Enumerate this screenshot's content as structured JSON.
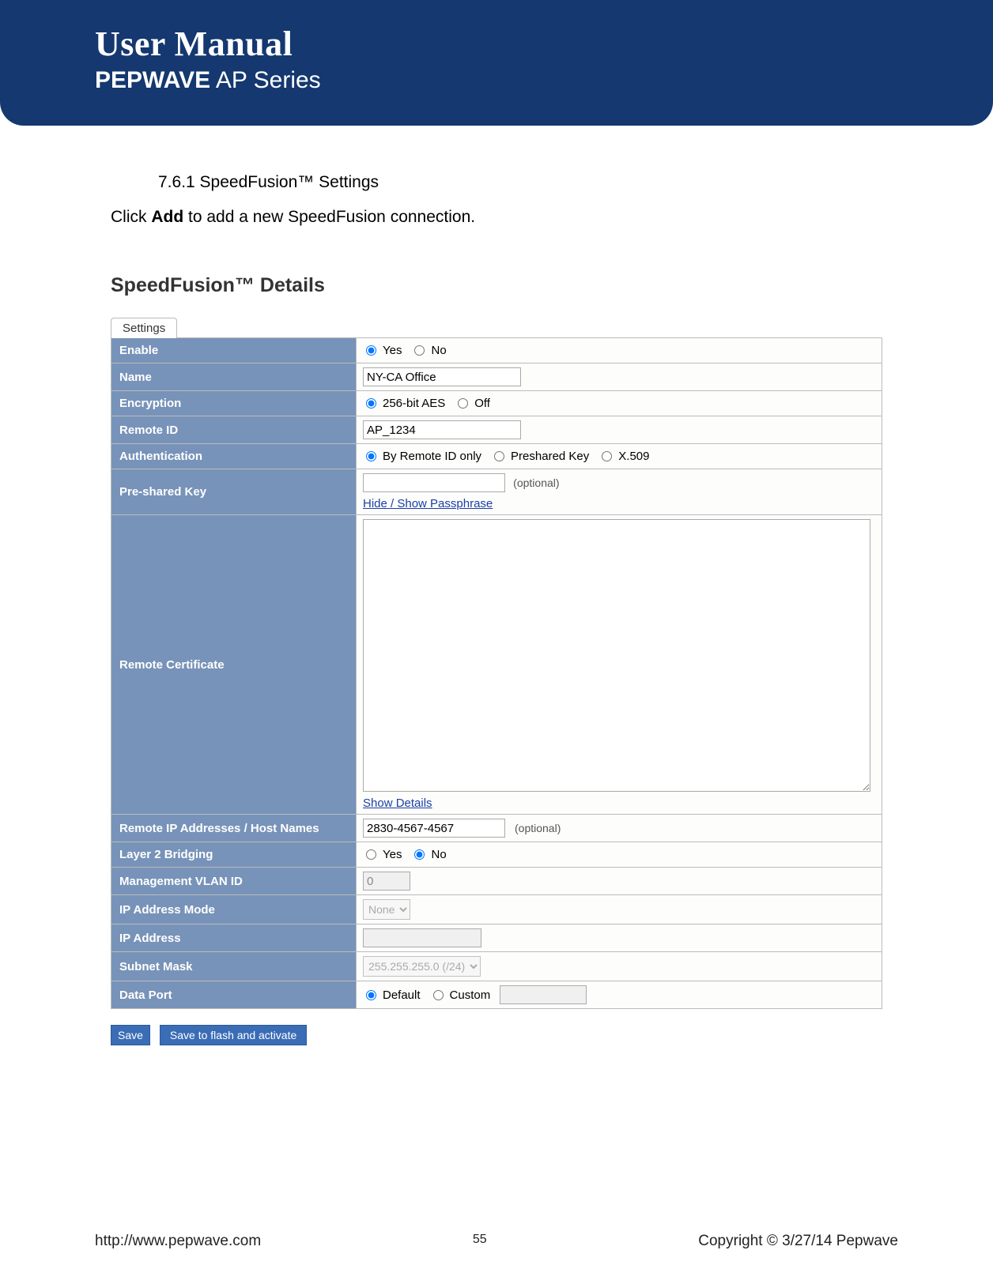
{
  "header": {
    "title": "User Manual",
    "brand": "PEPWAVE",
    "series": " AP Series"
  },
  "section": {
    "number": "7.6.1 SpeedFusion™ Settings",
    "intro_pre": "Click ",
    "intro_bold": "Add",
    "intro_post": " to add a new SpeedFusion connection.",
    "details_title": "SpeedFusion™ Details",
    "tab_label": "Settings"
  },
  "settings": {
    "enable": {
      "label": "Enable",
      "yes": "Yes",
      "no": "No",
      "selected": "yes"
    },
    "name": {
      "label": "Name",
      "value": "NY-CA Office"
    },
    "encryption": {
      "label": "Encryption",
      "aes": "256-bit AES",
      "off": "Off",
      "selected": "aes"
    },
    "remote_id": {
      "label": "Remote ID",
      "value": "AP_1234"
    },
    "authentication": {
      "label": "Authentication",
      "by_id": "By Remote ID only",
      "psk": "Preshared Key",
      "x509": "X.509",
      "selected": "by_id"
    },
    "psk": {
      "label": "Pre-shared Key",
      "value": "",
      "optional": "(optional)",
      "toggle_link": "Hide / Show Passphrase"
    },
    "remote_cert": {
      "label": "Remote Certificate",
      "value": "",
      "details_link": "Show Details"
    },
    "remote_ip": {
      "label": "Remote IP Addresses / Host Names",
      "value": "2830-4567-4567",
      "optional": "(optional)"
    },
    "l2_bridging": {
      "label": "Layer 2 Bridging",
      "yes": "Yes",
      "no": "No",
      "selected": "no"
    },
    "vlan": {
      "label": "Management VLAN ID",
      "value": "0"
    },
    "ip_mode": {
      "label": "IP Address Mode",
      "value": "None"
    },
    "ip_addr": {
      "label": "IP Address",
      "value": ""
    },
    "subnet": {
      "label": "Subnet Mask",
      "value": "255.255.255.0 (/24)"
    },
    "data_port": {
      "label": "Data Port",
      "def": "Default",
      "custom": "Custom",
      "selected": "def",
      "custom_value": ""
    }
  },
  "buttons": {
    "save": "Save",
    "save_activate": "Save to flash and activate"
  },
  "footer": {
    "url": "http://www.pepwave.com",
    "page": "55",
    "copyright": "Copyright © 3/27/14 Pepwave"
  }
}
